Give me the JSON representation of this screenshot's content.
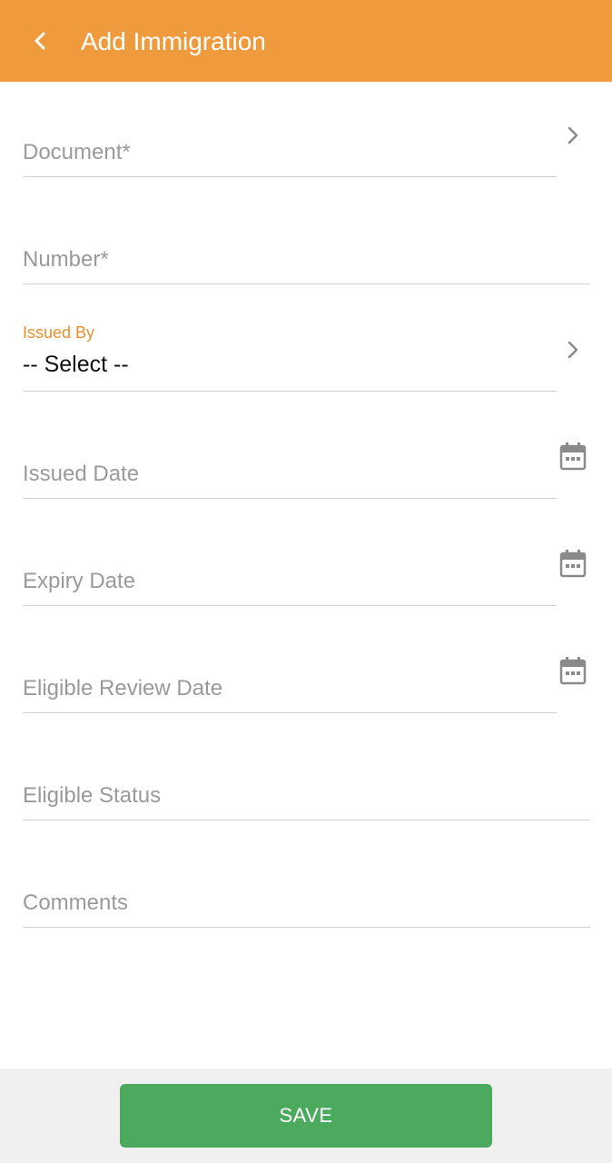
{
  "appbar": {
    "title": "Add Immigration",
    "back_icon": "chevron-left-icon",
    "color": "#f09a3e"
  },
  "form": {
    "document": {
      "placeholder": "Document*",
      "icon": "chevron-right-icon"
    },
    "number": {
      "placeholder": "Number*"
    },
    "issued_by": {
      "label": "Issued By",
      "value": "-- Select --",
      "icon": "chevron-right-icon"
    },
    "issued_date": {
      "placeholder": "Issued Date",
      "icon": "calendar-icon"
    },
    "expiry_date": {
      "placeholder": "Expiry Date",
      "icon": "calendar-icon"
    },
    "eligible_review_date": {
      "placeholder": "Eligible Review Date",
      "icon": "calendar-icon"
    },
    "eligible_status": {
      "placeholder": "Eligible Status"
    },
    "comments": {
      "placeholder": "Comments"
    }
  },
  "footer": {
    "save_label": "SAVE",
    "save_color": "#4caa5e"
  }
}
